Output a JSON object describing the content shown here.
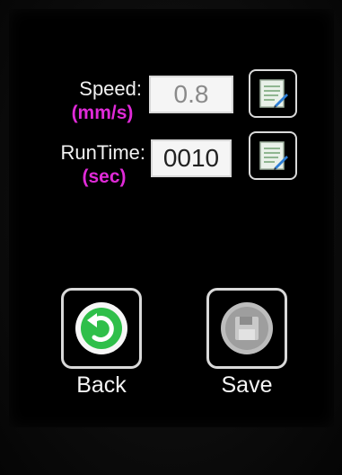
{
  "speed": {
    "label": "Speed:",
    "unit": "(mm/s)",
    "value": "0.8"
  },
  "runtime": {
    "label": "RunTime:",
    "unit": "(sec)",
    "value": "0010"
  },
  "buttons": {
    "back_label": "Back",
    "save_label": "Save"
  },
  "icons": {
    "edit": "edit-note-icon",
    "back": "undo-arrow-icon",
    "save": "floppy-disk-icon"
  },
  "colors": {
    "unit_text": "#e02ad8",
    "back_green": "#2fbf4a",
    "save_gray": "#a0a0a0"
  }
}
